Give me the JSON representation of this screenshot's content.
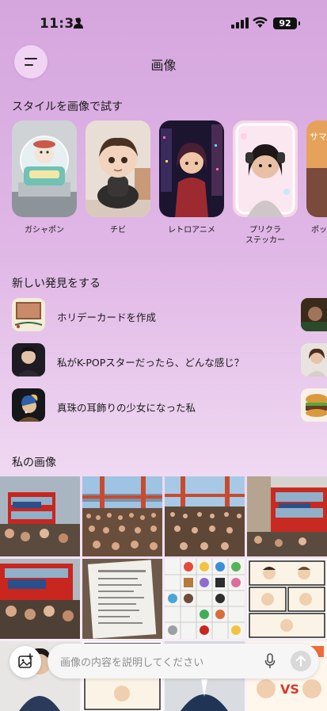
{
  "status_bar": {
    "time": "11:31",
    "battery": "92"
  },
  "header": {
    "title": "画像"
  },
  "styles_section": {
    "title": "スタイルを画像で試す",
    "items": [
      {
        "label": "ガシャポン"
      },
      {
        "label": "チビ"
      },
      {
        "label": "レトロアニメ"
      },
      {
        "label": "プリクラ\nステッカー"
      },
      {
        "label": "ポッ"
      }
    ]
  },
  "discover_section": {
    "title": "新しい発見をする",
    "items": [
      {
        "label": "ホリデーカードを作成"
      },
      {
        "label": "私がK-POPスターだったら、どんな感じ？"
      },
      {
        "label": "真珠の耳飾りの少女になった私"
      }
    ]
  },
  "my_images": {
    "title": "私の画像"
  },
  "composer": {
    "placeholder": "画像の内容を説明してください"
  }
}
